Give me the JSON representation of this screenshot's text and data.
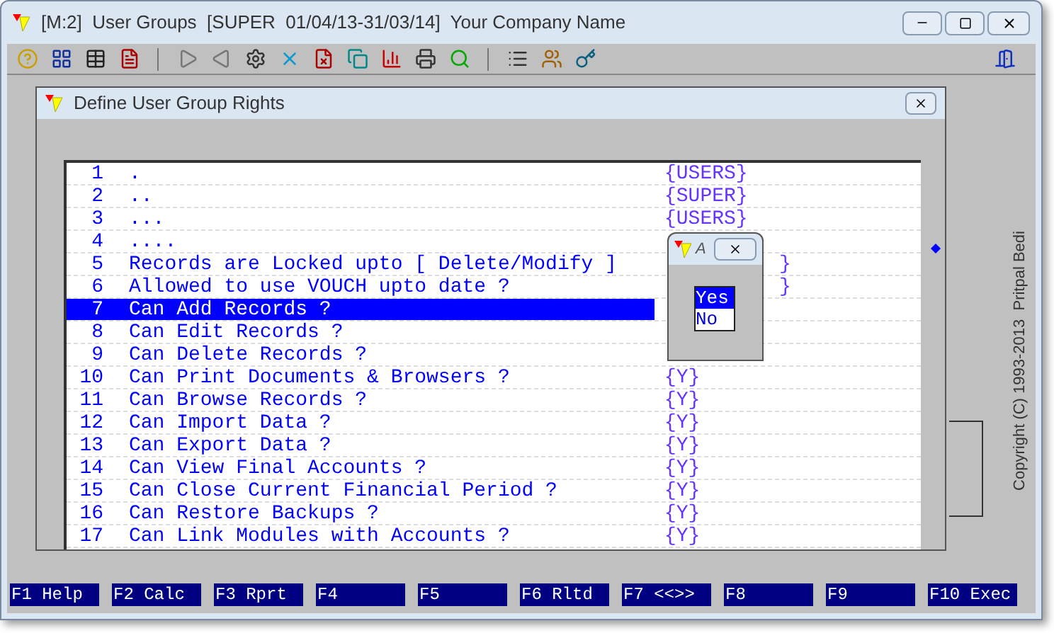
{
  "window": {
    "title": "[M:2]  User Groups  [SUPER  01/04/13-31/03/14]  Your Company Name"
  },
  "dialog": {
    "title": "Define User Group Rights"
  },
  "rows": [
    {
      "number": "1",
      "text": ".",
      "value": "{USERS}",
      "kind": "full",
      "selected": false
    },
    {
      "number": "2",
      "text": "..",
      "value": "{SUPER}",
      "kind": "full",
      "selected": false
    },
    {
      "number": "3",
      "text": "...",
      "value": "{USERS}",
      "kind": "full",
      "selected": false
    },
    {
      "number": "4",
      "text": "....",
      "kind": "none",
      "selected": false
    },
    {
      "number": "5",
      "text": "Records are Locked upto [ Delete/Modify ]",
      "value": "}",
      "kind": "tail",
      "selected": false
    },
    {
      "number": "6",
      "text": "Allowed to use VOUCH upto date ?",
      "value": "}",
      "kind": "tail",
      "selected": false
    },
    {
      "number": "7",
      "text": "Can Add Records ?",
      "kind": "none",
      "selected": true
    },
    {
      "number": "8",
      "text": "Can Edit Records ?",
      "kind": "none",
      "selected": false
    },
    {
      "number": "9",
      "text": "Can Delete Records ?",
      "kind": "none",
      "selected": false
    },
    {
      "number": "10",
      "text": "Can Print Documents & Browsers ?",
      "value": "{Y}",
      "kind": "full",
      "selected": false
    },
    {
      "number": "11",
      "text": "Can Browse Records ?",
      "value": "{Y}",
      "kind": "full",
      "selected": false
    },
    {
      "number": "12",
      "text": "Can Import Data ?",
      "value": "{Y}",
      "kind": "full",
      "selected": false
    },
    {
      "number": "13",
      "text": "Can Export Data ?",
      "value": "{Y}",
      "kind": "full",
      "selected": false
    },
    {
      "number": "14",
      "text": "Can View Final Accounts ?",
      "value": "{Y}",
      "kind": "full",
      "selected": false
    },
    {
      "number": "15",
      "text": "Can Close Current Financial Period ?",
      "value": "{Y}",
      "kind": "full",
      "selected": false
    },
    {
      "number": "16",
      "text": "Can Restore Backups ?",
      "value": "{Y}",
      "kind": "full",
      "selected": false
    },
    {
      "number": "17",
      "text": "Can Link Modules with Accounts ?",
      "value": "{Y}",
      "kind": "full",
      "selected": false
    }
  ],
  "popup": {
    "title": "A",
    "options": [
      {
        "label": "Yes",
        "selected": true
      },
      {
        "label": "No",
        "selected": false
      }
    ]
  },
  "copyright": "Copyright (C) 1993-2013  Pritpal Bedi",
  "function_keys": [
    "F1 Help",
    "F2 Calc",
    "F3 Rprt",
    "F4",
    "F5",
    "F6 Rltd",
    "F7 <<>>",
    "F8",
    "F9",
    "F10 Exec"
  ]
}
